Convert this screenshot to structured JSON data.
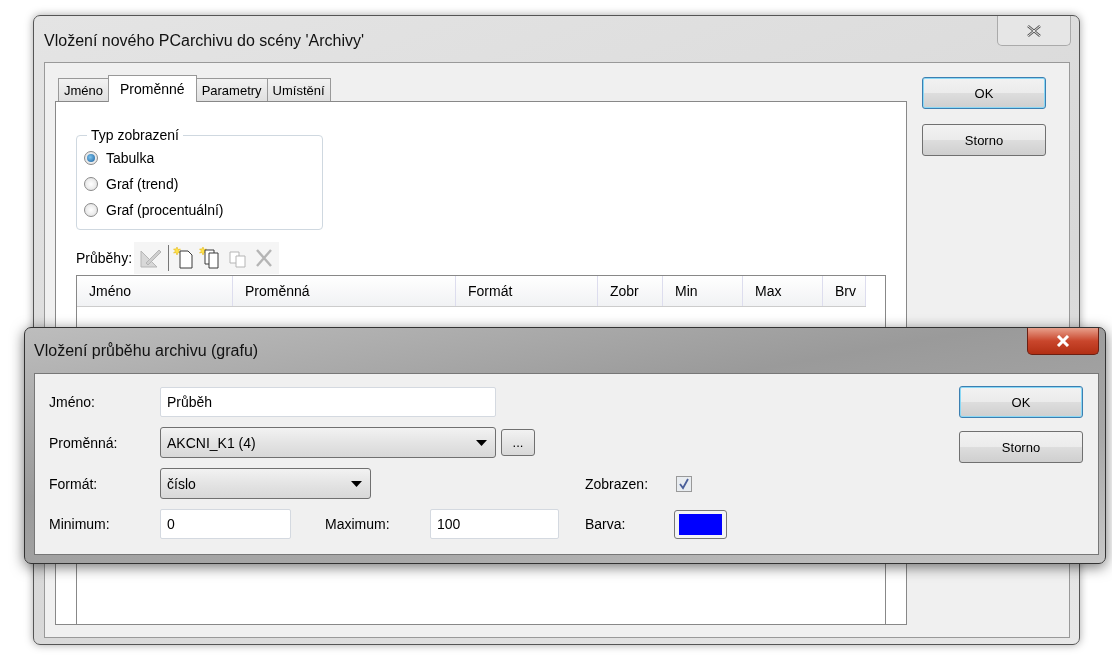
{
  "main_window": {
    "title": "Vložení nového PCarchivu do scény 'Archivy'",
    "tabs": [
      {
        "label": "Jméno",
        "selected": false
      },
      {
        "label": "Proměnné",
        "selected": true
      },
      {
        "label": "Parametry",
        "selected": false
      },
      {
        "label": "Umístění",
        "selected": false
      }
    ],
    "display_type": {
      "legend": "Typ zobrazení",
      "options": [
        {
          "label": "Tabulka",
          "selected": true
        },
        {
          "label": "Graf (trend)",
          "selected": false
        },
        {
          "label": "Graf (procentuální)",
          "selected": false
        }
      ]
    },
    "curves": {
      "label": "Průběhy:",
      "toolbar": [
        {
          "kind": "edit",
          "disabled": true
        },
        {
          "kind": "new",
          "disabled": false
        },
        {
          "kind": "duplicate",
          "disabled": false
        },
        {
          "kind": "copy",
          "disabled": true
        },
        {
          "kind": "delete",
          "disabled": true
        }
      ],
      "columns": [
        "Jméno",
        "Proměnná",
        "Formát",
        "Zobr",
        "Min",
        "Max",
        "Brv"
      ]
    },
    "buttons": [
      {
        "label": "OK",
        "default": true
      },
      {
        "label": "Storno",
        "default": false
      }
    ]
  },
  "curve_dialog": {
    "title": "Vložení průběhu archivu (grafu)",
    "name": {
      "label": "Jméno:",
      "value": "Průběh"
    },
    "variable": {
      "label": "Proměnná:",
      "value": "AKCNI_K1 (4)",
      "browse": "..."
    },
    "format": {
      "label": "Formát:",
      "value": "číslo"
    },
    "minimum": {
      "label": "Minimum:",
      "value": "0"
    },
    "maximum": {
      "label": "Maximum:",
      "value": "100"
    },
    "shown": {
      "label": "Zobrazen:",
      "checked": true,
      "disabled": true
    },
    "color": {
      "label": "Barva:",
      "color": "#0000ff"
    },
    "buttons": [
      {
        "label": "OK",
        "default": true
      },
      {
        "label": "Storno",
        "default": false
      }
    ]
  }
}
